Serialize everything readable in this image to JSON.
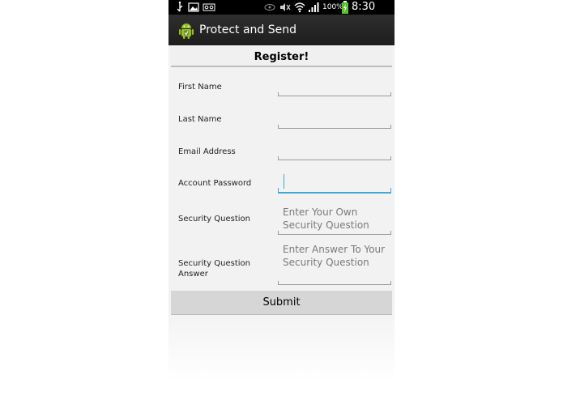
{
  "status_bar": {
    "battery": "100%",
    "time": "8:30 AM"
  },
  "app": {
    "title": "Protect and Send"
  },
  "form": {
    "heading": "Register!",
    "fields": [
      {
        "label": "First Name",
        "value": "",
        "placeholder": ""
      },
      {
        "label": "Last Name",
        "value": "",
        "placeholder": ""
      },
      {
        "label": "Email Address",
        "value": "",
        "placeholder": ""
      },
      {
        "label": "Account Password",
        "value": "",
        "placeholder": ""
      },
      {
        "label": "Security Question",
        "value": "",
        "placeholder": "Enter Your Own Security Question"
      },
      {
        "label": "Security Question Answer",
        "value": "",
        "placeholder": "Enter Answer To Your Security Question"
      }
    ],
    "submit_label": "Submit"
  },
  "colors": {
    "focus_accent": "#3fa8d4",
    "android_green": "#97c024",
    "action_bar": "#262626"
  }
}
